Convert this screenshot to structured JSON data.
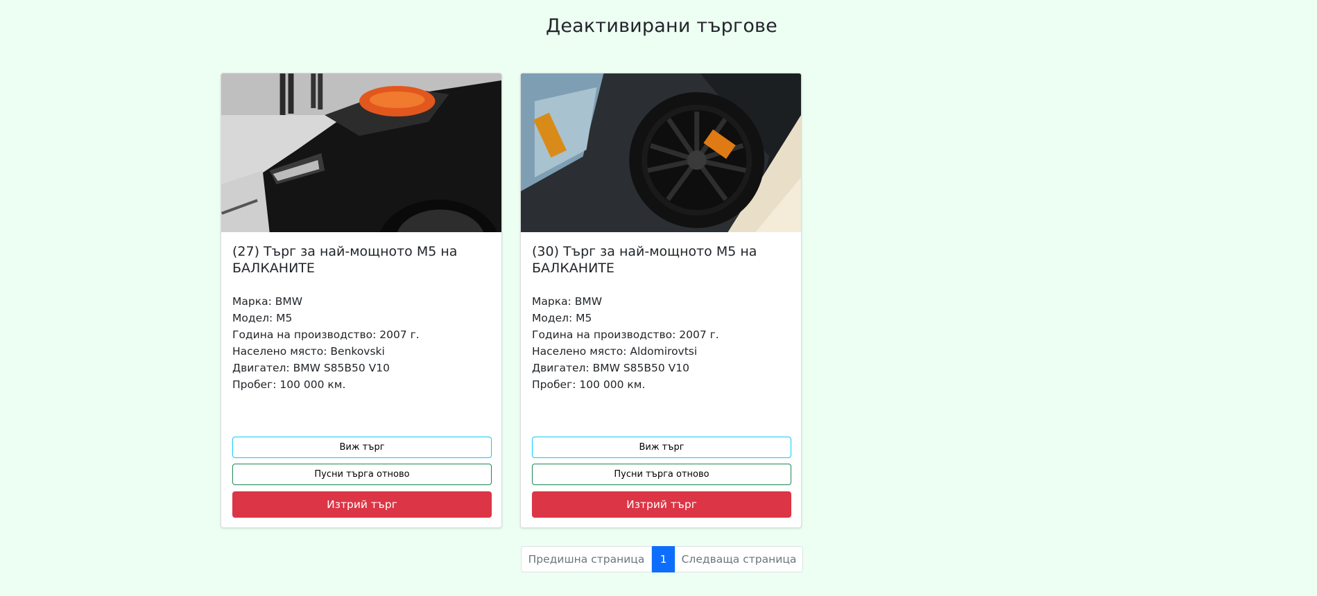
{
  "page": {
    "title": "Деактивирани търгове"
  },
  "cards": [
    {
      "image": "car-engine-photo",
      "title": "(27) Търг за най-мощното М5 на БАЛКАНИТЕ",
      "specs": {
        "brand": "Марка: BMW",
        "model": "Модел: M5",
        "year": "Година на производство: 2007 г.",
        "place": "Населено място: Benkovski",
        "engine": "Двигател: BMW S85B50 V10",
        "mileage": "Пробег: 100 000 км."
      },
      "buttons": {
        "view": "Виж търг",
        "restart": "Пусни търга отново",
        "delete": "Изтрий търг"
      }
    },
    {
      "image": "car-wheel-photo",
      "title": "(30) Търг за най-мощното М5 на БАЛКАНИТЕ",
      "specs": {
        "brand": "Марка: BMW",
        "model": "Модел: M5",
        "year": "Година на производство: 2007 г.",
        "place": "Населено място: Aldomirovtsi",
        "engine": "Двигател: BMW S85B50 V10",
        "mileage": "Пробег: 100 000 км."
      },
      "buttons": {
        "view": "Виж търг",
        "restart": "Пусни търга отново",
        "delete": "Изтрий търг"
      }
    }
  ],
  "pagination": {
    "prev": "Предишна страница",
    "current": "1",
    "next": "Следваща страница"
  },
  "colors": {
    "background": "#edfff3",
    "info": "#0dcaf0",
    "success": "#198754",
    "danger": "#dc3545",
    "primary": "#0d6efd"
  }
}
